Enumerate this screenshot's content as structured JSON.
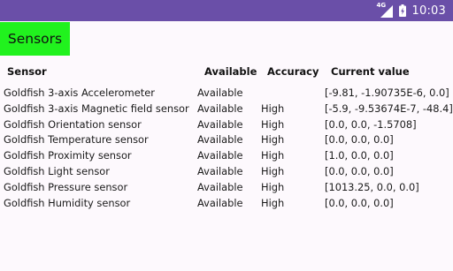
{
  "status_bar": {
    "network_type": "4G",
    "time": "10:03",
    "background_color": "#6a4fa8"
  },
  "app": {
    "title": "Sensors",
    "title_background": "#21f21e"
  },
  "table": {
    "headers": [
      "Sensor",
      "Available",
      "Accuracy",
      "Current value"
    ],
    "rows": [
      [
        "Goldfish 3-axis Accelerometer",
        "Available",
        "",
        "[-9.81, -1.90735E-6, 0.0]"
      ],
      [
        "Goldfish 3-axis Magnetic field sensor",
        "Available",
        "High",
        "[-5.9, -9.53674E-7, -48.4]"
      ],
      [
        "Goldfish Orientation sensor",
        "Available",
        "High",
        "[0.0, 0.0, -1.5708]"
      ],
      [
        "Goldfish Temperature sensor",
        "Available",
        "High",
        "[0.0, 0.0, 0.0]"
      ],
      [
        "Goldfish Proximity sensor",
        "Available",
        "High",
        "[1.0, 0.0, 0.0]"
      ],
      [
        "Goldfish Light sensor",
        "Available",
        "High",
        "[0.0, 0.0, 0.0]"
      ],
      [
        "Goldfish Pressure sensor",
        "Available",
        "High",
        "[1013.25, 0.0, 0.0]"
      ],
      [
        "Goldfish Humidity sensor",
        "Available",
        "High",
        "[0.0, 0.0, 0.0]"
      ]
    ]
  }
}
